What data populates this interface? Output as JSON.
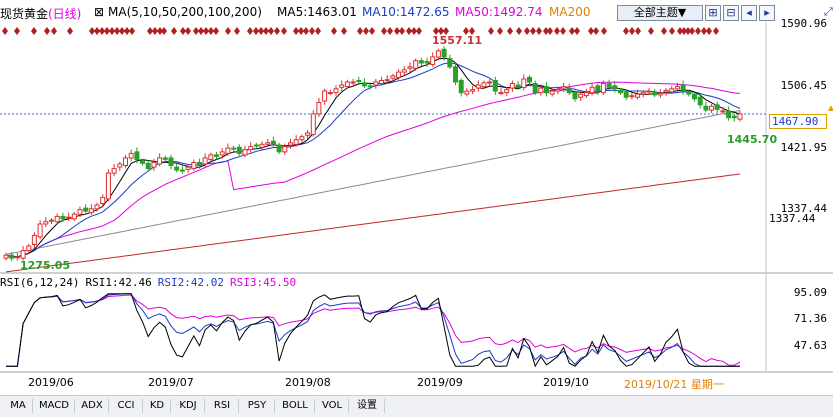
{
  "header": {
    "instrument": "现货黄金",
    "period": "(日线)",
    "ma_label": "MA(5,10,50,200,100,200)",
    "ma5": "MA5:1463.01",
    "ma10": "MA10:1472.65",
    "ma50": "MA50:1492.74",
    "ma200": "MA200",
    "theme_button": "全部主题▼",
    "icons": [
      "zoom-in-icon",
      "zoom-out-icon",
      "scroll-left-icon",
      "scroll-right-icon",
      "expand-icon"
    ],
    "colors": {
      "ma5": "#000000",
      "ma10": "#1a3cc8",
      "ma50": "#e000e0",
      "ma200": "#e08000"
    }
  },
  "price_axis": [
    "1590.96",
    "1506.45",
    "1421.95",
    "1337.44"
  ],
  "price_box": "1467.90",
  "annotations": {
    "high": "1557.11",
    "recent_low": "1445.70",
    "low": "1275.05",
    "level_label": "1337.44"
  },
  "rsi": {
    "label": "RSI(6,12,24)",
    "rsi1": "RSI1:42.46",
    "rsi2": "RSI2:42.02",
    "rsi3": "RSI3:45.50",
    "axis": [
      "95.09",
      "71.36",
      "47.63"
    ]
  },
  "x_axis": [
    "2019/06",
    "2019/07",
    "2019/08",
    "2019/09",
    "2019/10"
  ],
  "cursor_date": "2019/10/21 星期一",
  "tabs": [
    "MA",
    "MACD",
    "ADX",
    "CCI",
    "KD",
    "KDJ",
    "RSI",
    "PSY",
    "BOLL",
    "VOL",
    "设置"
  ],
  "chart_data": {
    "type": "candlestick",
    "period": "daily",
    "start": "2019-05-27",
    "end": "2019-10-21",
    "close": [
      1284,
      1280,
      1282,
      1290,
      1296,
      1310,
      1325,
      1328,
      1330,
      1335,
      1332,
      1334,
      1338,
      1344,
      1342,
      1345,
      1350,
      1360,
      1392,
      1398,
      1404,
      1412,
      1418,
      1410,
      1405,
      1398,
      1406,
      1412,
      1410,
      1402,
      1396,
      1395,
      1400,
      1406,
      1402,
      1412,
      1416,
      1414,
      1420,
      1425,
      1424,
      1418,
      1423,
      1427,
      1428,
      1430,
      1432,
      1431,
      1420,
      1427,
      1432,
      1436,
      1440,
      1445,
      1470,
      1485,
      1500,
      1498,
      1503,
      1508,
      1512,
      1512,
      1513,
      1507,
      1506,
      1512,
      1514,
      1515,
      1520,
      1525,
      1528,
      1532,
      1540,
      1537,
      1537,
      1545,
      1553,
      1545,
      1532,
      1512,
      1498,
      1500,
      1502,
      1508,
      1511,
      1512,
      1500,
      1498,
      1502,
      1510,
      1505,
      1516,
      1512,
      1498,
      1504,
      1498,
      1500,
      1502,
      1506,
      1498,
      1490,
      1496,
      1498,
      1505,
      1500,
      1510,
      1505,
      1503,
      1498,
      1492,
      1494,
      1496,
      1498,
      1500,
      1495,
      1497,
      1501,
      1503,
      1506,
      1500,
      1496,
      1490,
      1482,
      1475,
      1480,
      1476,
      1474,
      1465,
      1465,
      1470
    ],
    "ma_lines": [
      "MA5",
      "MA10",
      "MA50",
      "MA200"
    ],
    "highlights": {
      "high": 1557.11,
      "recent_low": 1445.7,
      "low": 1275.05,
      "last": 1467.9
    },
    "ylim": [
      1275,
      1591
    ],
    "rsi": {
      "rsi1": 42.46,
      "rsi2": 42.02,
      "rsi3": 45.5,
      "ylim": [
        35,
        98
      ]
    }
  }
}
